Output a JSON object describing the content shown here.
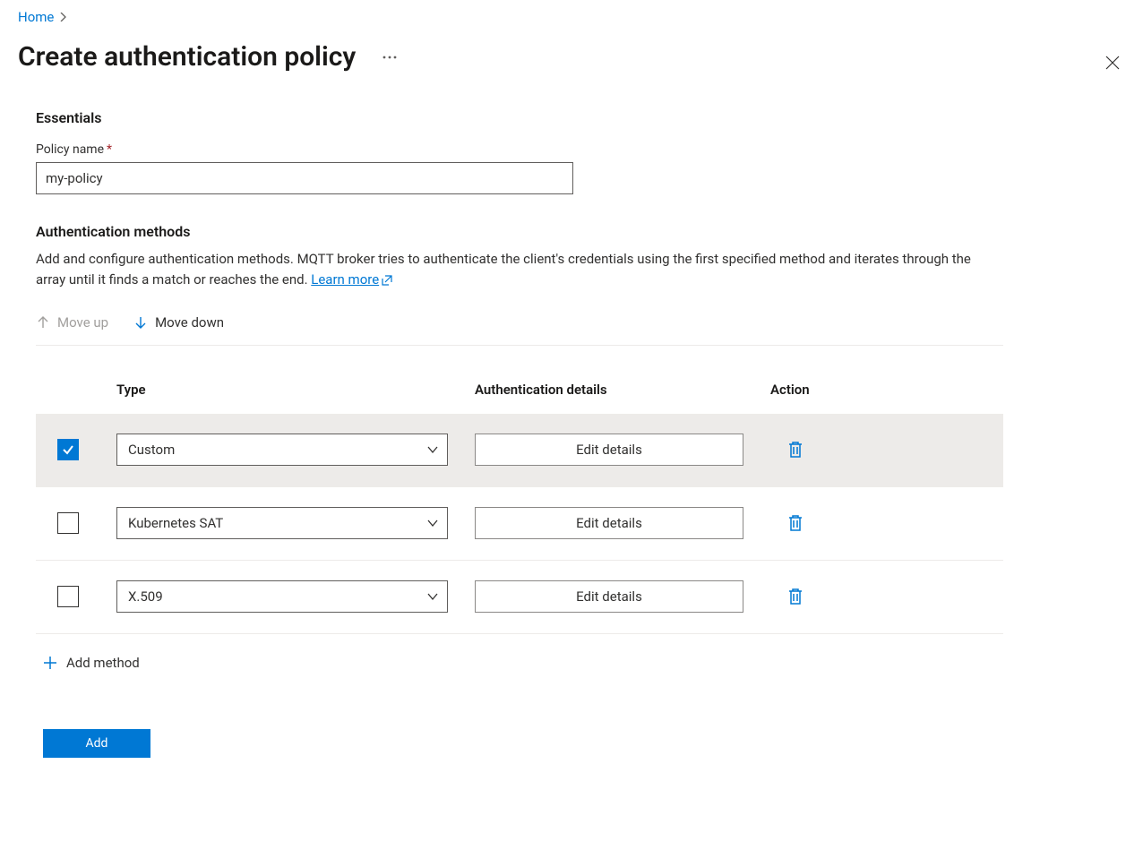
{
  "breadcrumb": {
    "home": "Home"
  },
  "page": {
    "title": "Create authentication policy"
  },
  "essentials": {
    "heading": "Essentials",
    "policy_name_label": "Policy name",
    "policy_name_value": "my-policy"
  },
  "auth_section": {
    "heading": "Authentication methods",
    "description_part1": "Add and configure authentication methods. MQTT broker tries to authenticate the client's credentials using the first specified method and iterates through the array until it finds a match or reaches the end. ",
    "learn_more": "Learn more"
  },
  "move": {
    "up": "Move up",
    "down": "Move down"
  },
  "table": {
    "col_type": "Type",
    "col_details": "Authentication details",
    "col_action": "Action",
    "edit_label": "Edit details",
    "rows": [
      {
        "checked": true,
        "type": "Custom"
      },
      {
        "checked": false,
        "type": "Kubernetes SAT"
      },
      {
        "checked": false,
        "type": "X.509"
      }
    ]
  },
  "add_method": "Add method",
  "footer": {
    "add": "Add"
  }
}
